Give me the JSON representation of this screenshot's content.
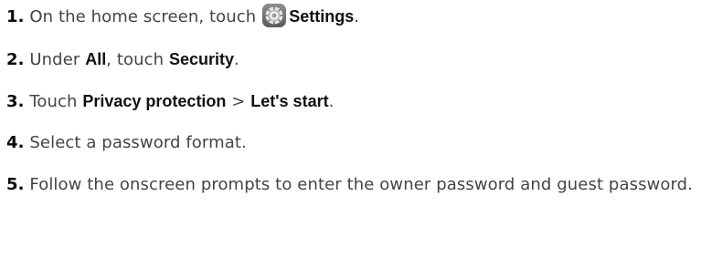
{
  "steps": [
    {
      "number": "1.",
      "text_before": "On the home screen, touch",
      "icon": "settings-gear-icon",
      "bold_1": "Settings",
      "text_after": "."
    },
    {
      "number": "2.",
      "text_1": "Under ",
      "bold_1": "All",
      "text_2": ", touch ",
      "bold_2": "Security",
      "text_3": "."
    },
    {
      "number": "3.",
      "text_1": "Touch ",
      "bold_1": "Privacy protection",
      "separator": " > ",
      "bold_2": "Let's start",
      "text_2": "."
    },
    {
      "number": "4.",
      "text": "Select a password format."
    },
    {
      "number": "5.",
      "text": "Follow the onscreen prompts to enter the owner password and guest password."
    }
  ]
}
